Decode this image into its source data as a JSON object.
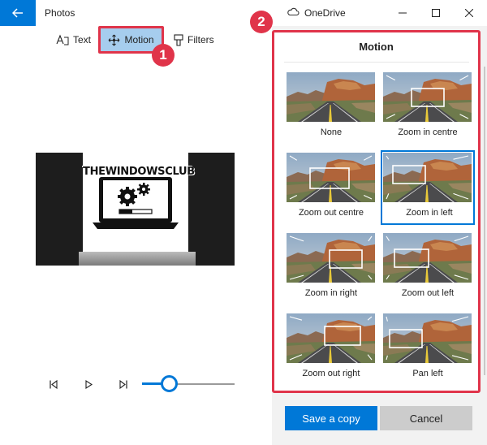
{
  "titlebar": {
    "app_title": "Photos",
    "onedrive_label": "OneDrive",
    "back_icon": "arrow-left-icon",
    "minimize_icon": "minimize-icon",
    "maximize_icon": "maximize-icon",
    "close_icon": "close-icon",
    "accent_color": "#0078d7"
  },
  "toolbar": {
    "items": [
      {
        "label": "Text",
        "icon": "text-icon",
        "selected": false
      },
      {
        "label": "Motion",
        "icon": "motion-icon",
        "selected": true
      },
      {
        "label": "Filters",
        "icon": "filters-icon",
        "selected": false
      }
    ]
  },
  "callouts": {
    "first": "1",
    "second": "2",
    "color": "#e0344a"
  },
  "preview": {
    "brand_text": "THEWINDOWSCLUB"
  },
  "playback": {
    "controls": [
      "step-back-icon",
      "play-icon",
      "step-forward-icon"
    ],
    "position_fraction": 0.29
  },
  "motion_panel": {
    "heading": "Motion",
    "options": [
      {
        "label": "None",
        "selected": false
      },
      {
        "label": "Zoom in centre",
        "selected": false
      },
      {
        "label": "Zoom out centre",
        "selected": false
      },
      {
        "label": "Zoom in left",
        "selected": true
      },
      {
        "label": "Zoom in right",
        "selected": false
      },
      {
        "label": "Zoom out left",
        "selected": false
      },
      {
        "label": "Zoom out right",
        "selected": false
      },
      {
        "label": "Pan left",
        "selected": false
      }
    ],
    "save_label": "Save a copy",
    "cancel_label": "Cancel"
  }
}
